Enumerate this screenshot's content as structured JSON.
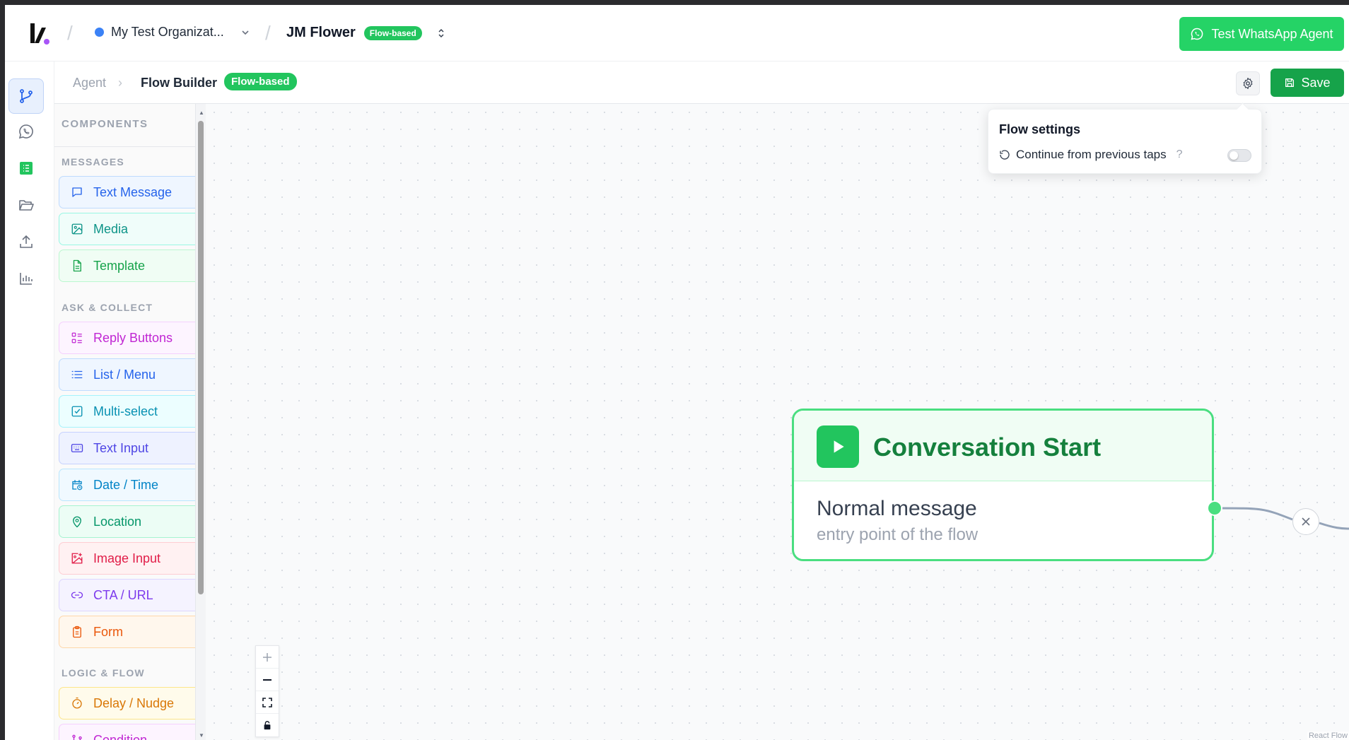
{
  "header": {
    "org_name": "My Test Organizat...",
    "agent_name": "JM Flower",
    "agent_badge": "Flow-based",
    "test_button": "Test WhatsApp Agent"
  },
  "subheader": {
    "crumb_agent": "Agent",
    "crumb_separator": "›",
    "crumb_current": "Flow Builder",
    "badge": "Flow-based",
    "save_label": "Save"
  },
  "rail": {
    "items": [
      "flow-branch-icon",
      "whatsapp-icon",
      "list-doc-icon",
      "folder-open-icon",
      "upload-icon",
      "bar-chart-icon"
    ]
  },
  "components": {
    "title": "COMPONENTS",
    "sections": {
      "messages": "MESSAGES",
      "ask_collect": "ASK & COLLECT",
      "logic_flow": "LOGIC & FLOW"
    },
    "items": [
      {
        "label": "Text Message",
        "icon": "chat-bubble-icon"
      },
      {
        "label": "Media",
        "icon": "image-icon"
      },
      {
        "label": "Template",
        "icon": "document-icon"
      },
      {
        "label": "Reply Buttons",
        "icon": "list-grid-icon"
      },
      {
        "label": "List / Menu",
        "icon": "list-icon"
      },
      {
        "label": "Multi-select",
        "icon": "checkbox-icon"
      },
      {
        "label": "Text Input",
        "icon": "keyboard-icon"
      },
      {
        "label": "Date / Time",
        "icon": "calendar-clock-icon"
      },
      {
        "label": "Location",
        "icon": "map-pin-icon"
      },
      {
        "label": "Image Input",
        "icon": "image-plus-icon"
      },
      {
        "label": "CTA / URL",
        "icon": "link-icon"
      },
      {
        "label": "Form",
        "icon": "clipboard-icon"
      },
      {
        "label": "Delay / Nudge",
        "icon": "timer-icon"
      },
      {
        "label": "Condition",
        "icon": "branch-icon"
      }
    ],
    "colors": {
      "text_message": "#2563eb",
      "media": "#0d9488",
      "template": "#16a34a",
      "reply_buttons": "#c026d3",
      "list_menu": "#2563eb",
      "multi_select": "#0891b2",
      "text_input": "#4f46e5",
      "date_time": "#0284c7",
      "location": "#059669",
      "image_input": "#e11d48",
      "cta_url": "#7c3aed",
      "form": "#ea580c",
      "delay_nudge": "#d97706",
      "condition": "#c026d3"
    }
  },
  "flow_settings": {
    "title": "Flow settings",
    "option_label": "Continue from previous taps",
    "help": "?",
    "option_enabled": false
  },
  "start_node": {
    "title": "Conversation Start",
    "subtitle": "Normal message",
    "description": "entry point of the flow"
  },
  "canvas": {
    "attribution": "React Flow"
  },
  "colors": {
    "accent_green": "#22c55e",
    "whatsapp_green": "#25d366",
    "save_green": "#16a34a",
    "node_border": "#4ade80"
  }
}
